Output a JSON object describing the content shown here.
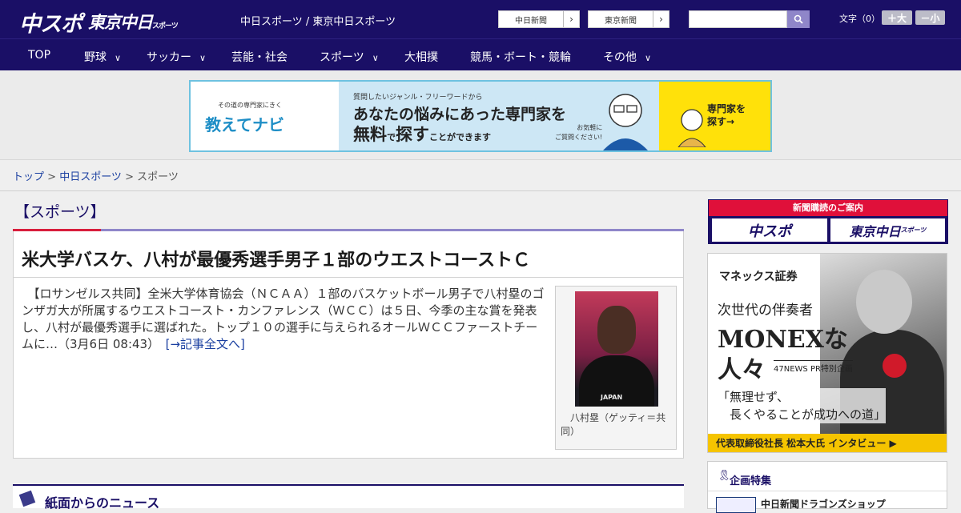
{
  "header": {
    "logo_chuspo": "中スポ",
    "logo_tokyo": "東京中日",
    "logo_tokyo_small": "スポーツ",
    "site_links": "中日スポーツ / 東京中日スポーツ",
    "btn_chunichi": "中日新聞",
    "btn_tokyo": "東京新聞",
    "fontsize_label": "文字（0）",
    "fontsize_plus": "＋大",
    "fontsize_minus": "－小",
    "search_placeholder": ""
  },
  "nav": {
    "items": [
      {
        "label": "TOP",
        "has_menu": false
      },
      {
        "label": "野球",
        "has_menu": true
      },
      {
        "label": "サッカー",
        "has_menu": true
      },
      {
        "label": "芸能・社会",
        "has_menu": false
      },
      {
        "label": "スポーツ",
        "has_menu": true
      },
      {
        "label": "大相撲",
        "has_menu": false
      },
      {
        "label": "競馬・ボート・競輪",
        "has_menu": false
      },
      {
        "label": "その他",
        "has_menu": true
      }
    ]
  },
  "banner": {
    "small": "その道の専門家にきく",
    "logo": "教えてナビ",
    "t1": "質問したいジャンル・フリーワードから",
    "t2": "あなたの悩みにあった専門家を",
    "t3a": "無料",
    "t3b": "で",
    "t3c": "探す",
    "t3d": "ことができます",
    "t4a": "お気軽に",
    "t4b": "ご質問ください!",
    "cta1": "専門家を",
    "cta2": "探す→"
  },
  "breadcrumb": {
    "top": "トップ",
    "chunichi": "中日スポーツ",
    "current": "スポーツ",
    "sep": " > "
  },
  "category": {
    "title": "【スポーツ】"
  },
  "article": {
    "title": "米大学バスケ、八村が最優秀選手男子１部のウエストコーストＣ",
    "body": "【ロサンゼルス共同】全米大学体育協会（ＮＣＡＡ）１部のバスケットボール男子で八村塁のゴンザガ大が所属するウエストコースト・カンファレンス（ＷＣＣ）は５日、今季の主な賞を発表し、八村が最優秀選手に選ばれた。トップ１０の選手に与えられるオールＷＣＣファーストチームに…（3月6日 08:43）",
    "more": "[→記事全文へ]",
    "photo_jersey": "JAPAN",
    "caption": "八村塁（ゲッティ＝共同）"
  },
  "news": {
    "title": "紙面からのニュース"
  },
  "sidebar": {
    "sub_bar": "新聞購読のご案内",
    "sub_chuspo": "中スポ",
    "sub_tokyo": "東京中日",
    "sub_tokyo_small": "スポーツ",
    "ad_brand": "マネックス証券",
    "ad_t1": "次世代の伴奏者",
    "ad_t2": "MONEXな",
    "ad_t3": "人々",
    "ad_t4": "47NEWS PR特別企画",
    "ad_t5a": "「無理せず、",
    "ad_t5b": "長くやることが成功への道」",
    "ad_foot": "代表取締役社長 松本大氏 インタビュー ▶",
    "feat_title": "企画特集",
    "feat_item": "中日新聞ドラゴンズショップ"
  },
  "colors": {
    "header_bg": "#1a0f66",
    "accent_red": "#d81e3c",
    "accent_purple": "#8f86c9"
  }
}
